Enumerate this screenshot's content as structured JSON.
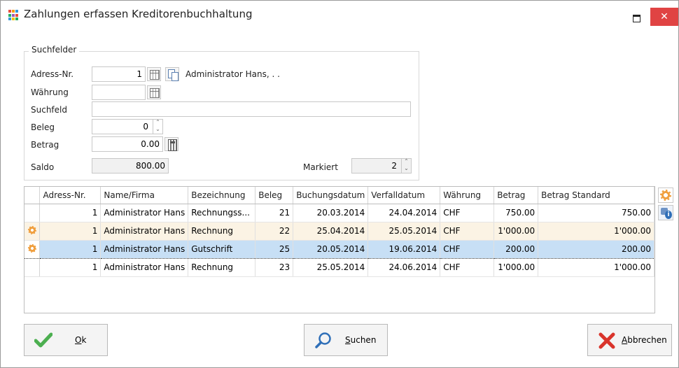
{
  "window": {
    "title": "Zahlungen erfassen Kreditorenbuchhaltung",
    "close_glyph": "✕"
  },
  "search": {
    "legend": "Suchfelder",
    "adress_nr": {
      "label": "Adress-Nr.",
      "value": "1",
      "name": "Administrator Hans, . ."
    },
    "waehrung": {
      "label": "Währung",
      "value": ""
    },
    "suchfeld": {
      "label": "Suchfeld",
      "value": ""
    },
    "beleg": {
      "label": "Beleg",
      "value": "0"
    },
    "betrag": {
      "label": "Betrag",
      "value": "0.00"
    },
    "saldo": {
      "label": "Saldo",
      "value": "800.00"
    },
    "markiert": {
      "label": "Markiert",
      "value": "2"
    }
  },
  "table": {
    "columns": [
      "Adress-Nr.",
      "Name/Firma",
      "Bezeichnung",
      "Beleg",
      "Buchungsdatum",
      "Verfalldatum",
      "Währung",
      "Betrag",
      "Betrag Standard"
    ],
    "rows": [
      {
        "marked": false,
        "adress_nr": "1",
        "name": "Administrator Hans",
        "bezeichnung": "Rechnungss...",
        "beleg": "21",
        "buchungsdatum": "20.03.2014",
        "verfalldatum": "24.04.2014",
        "waehrung": "CHF",
        "betrag": "750.00",
        "betrag_standard": "750.00"
      },
      {
        "marked": true,
        "adress_nr": "1",
        "name": "Administrator Hans",
        "bezeichnung": "Rechnung",
        "beleg": "22",
        "buchungsdatum": "25.04.2014",
        "verfalldatum": "25.05.2014",
        "waehrung": "CHF",
        "betrag": "1'000.00",
        "betrag_standard": "1'000.00"
      },
      {
        "marked": true,
        "adress_nr": "1",
        "name": "Administrator Hans",
        "bezeichnung": "Gutschrift",
        "beleg": "25",
        "buchungsdatum": "20.05.2014",
        "verfalldatum": "19.06.2014",
        "waehrung": "CHF",
        "betrag": "200.00",
        "betrag_standard": "200.00"
      },
      {
        "marked": false,
        "adress_nr": "1",
        "name": "Administrator Hans",
        "bezeichnung": "Rechnung",
        "beleg": "23",
        "buchungsdatum": "25.05.2014",
        "verfalldatum": "24.06.2014",
        "waehrung": "CHF",
        "betrag": "1'000.00",
        "betrag_standard": "1'000.00"
      }
    ]
  },
  "buttons": {
    "ok": {
      "label": "Ok",
      "mnemonic": "O",
      "rest": "k"
    },
    "suchen": {
      "label": "Suchen",
      "mnemonic": "S",
      "rest": "uchen"
    },
    "abbrechen": {
      "label": "Abbrechen",
      "mnemonic": "A",
      "rest": "bbrechen"
    }
  },
  "colors": {
    "accent": "#2f6fb8",
    "close": "#e04343",
    "ok_check": "#4caf50",
    "cancel_x": "#d9342b",
    "row_marked": "#fbf3e4",
    "row_selected": "#c7dff5"
  },
  "icons": [
    "app-grid-icon",
    "minimize-icon",
    "close-icon",
    "calendar-icon",
    "copy-icon",
    "spinner-icon",
    "calculator-icon",
    "gear-icon",
    "info-icon",
    "check-icon",
    "search-icon",
    "cancel-icon"
  ]
}
